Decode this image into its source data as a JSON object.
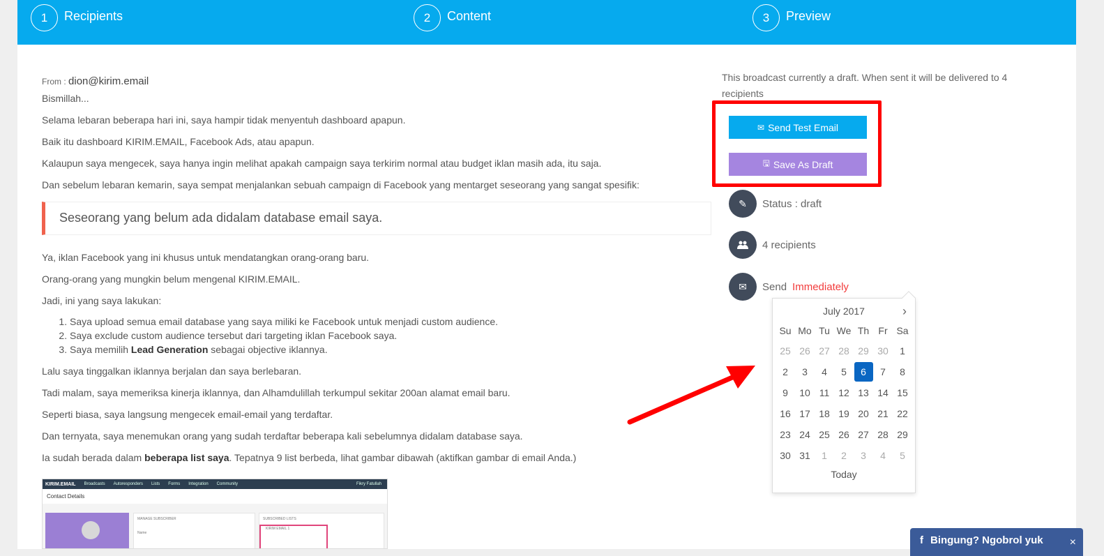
{
  "steps": [
    {
      "num": "1",
      "label": "Recipients"
    },
    {
      "num": "2",
      "label": "Content"
    },
    {
      "num": "3",
      "label": "Preview"
    }
  ],
  "email": {
    "from_label": "From :",
    "from_value": "dion@kirim.email",
    "paragraphs_top": [
      "Bismillah...",
      "Selama lebaran beberapa hari ini, saya hampir tidak menyentuh dashboard apapun.",
      "Baik itu dashboard KIRIM.EMAIL, Facebook Ads, atau apapun.",
      "Kalaupun saya mengecek, saya hanya ingin melihat apakah campaign saya terkirim normal atau budget iklan masih ada, itu saja.",
      "Dan sebelum lebaran kemarin, saya sempat menjalankan sebuah campaign di Facebook yang mentarget seseorang yang sangat spesifik:"
    ],
    "quote": "Seseorang yang belum ada didalam database email saya.",
    "paragraphs_mid": [
      "Ya, iklan Facebook yang ini khusus untuk mendatangkan orang-orang baru.",
      "Orang-orang yang mungkin belum mengenal KIRIM.EMAIL.",
      "Jadi, ini yang saya lakukan:"
    ],
    "list": [
      "Saya upload semua email database yang saya miliki ke Facebook untuk menjadi custom audience.",
      "Saya exclude custom audience tersebut dari targeting iklan Facebook saya."
    ],
    "list3_pre": "Saya memilih ",
    "list3_bold": "Lead Generation",
    "list3_post": " sebagai objective iklannya.",
    "paragraphs_bottom": [
      "Lalu saya tinggalkan iklannya berjalan dan saya berlebaran.",
      "Tadi malam, saya memeriksa kinerja iklannya, dan Alhamdulillah terkumpul sekitar 200an alamat email baru.",
      "Seperti biasa, saya langsung mengecek email-email yang terdaftar.",
      "Dan ternyata, saya menemukan orang yang sudah terdaftar beberapa kali sebelumnya didalam database saya."
    ],
    "last_pre": "Ia sudah berada dalam ",
    "last_bold": "beberapa list saya",
    "last_post": ". Tepatnya 9 list berbeda, lihat gambar dibawah (aktifkan gambar di email Anda.)",
    "screenshot": {
      "nav": [
        "Broadcasts",
        "Autoresponders",
        "Lists",
        "Forms",
        "Integration",
        "Community"
      ],
      "user": "Fikry Fatullah",
      "title": "Contact Details",
      "panel1": "MANAGE SUBSCRIBER",
      "panel1_field": "Name",
      "panel2": "SUBSCRIBED LISTS",
      "panel2_item": "KIRIM EMAIL 1",
      "logo": "KIRIM.EMAIL"
    }
  },
  "sidebar": {
    "draft_note": "This broadcast currently a draft. When sent it will be delivered to 4 recipients",
    "send_test_label": "Send Test Email",
    "save_draft_label": "Save As Draft",
    "status_text": "Status : draft",
    "recipients_text": "4 recipients",
    "send_label": "Send",
    "send_when": "Immediately"
  },
  "datepicker": {
    "month": "July 2017",
    "next": "›",
    "weekdays": [
      "Su",
      "Mo",
      "Tu",
      "We",
      "Th",
      "Fr",
      "Sa"
    ],
    "weeks": [
      [
        "25",
        "26",
        "27",
        "28",
        "29",
        "30",
        "1"
      ],
      [
        "2",
        "3",
        "4",
        "5",
        "6",
        "7",
        "8"
      ],
      [
        "9",
        "10",
        "11",
        "12",
        "13",
        "14",
        "15"
      ],
      [
        "16",
        "17",
        "18",
        "19",
        "20",
        "21",
        "22"
      ],
      [
        "23",
        "24",
        "25",
        "26",
        "27",
        "28",
        "29"
      ],
      [
        "30",
        "31",
        "1",
        "2",
        "3",
        "4",
        "5"
      ]
    ],
    "selected": "6",
    "today_label": "Today"
  },
  "chat": {
    "label": "Bingung? Ngobrol yuk",
    "close": "×"
  },
  "colors": {
    "step_bar": "#06aaee",
    "send_test": "#06aaee",
    "save_draft": "#a585e0",
    "highlight": "#ff0000",
    "selected_day": "#0a66c2",
    "immediately": "#f23b3b",
    "chat": "#3b5b99"
  },
  "icons": {
    "send_test": "envelope-icon",
    "save_draft": "floppy-disk-icon",
    "status": "pencil-icon",
    "recipients": "users-icon",
    "send": "envelope-icon",
    "next_month": "chevron-right-icon",
    "chat": "facebook-icon"
  }
}
